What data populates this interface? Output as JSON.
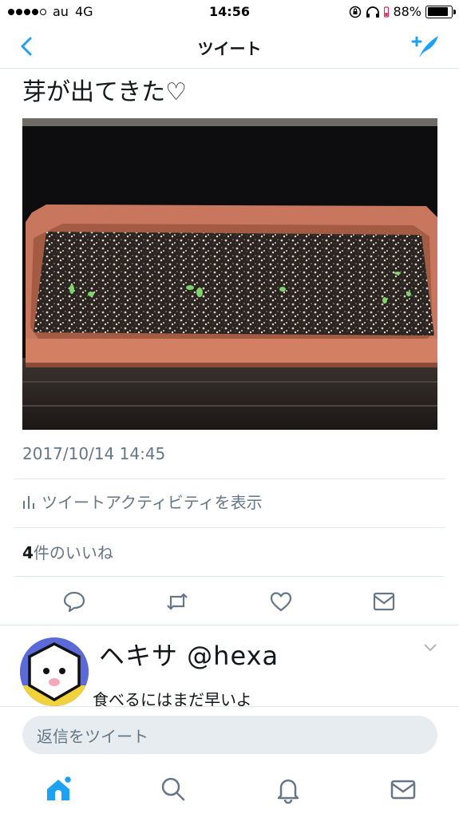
{
  "status_bar": {
    "carrier": "au",
    "network": "4G",
    "time": "14:56",
    "battery": "88%",
    "battery_level": 0.88
  },
  "nav": {
    "title": "ツイート",
    "back_icon": "chevron-left-icon",
    "compose_icon": "compose-tweet-icon"
  },
  "tweet": {
    "text": "芽が出てきた♡",
    "timestamp": "2017/10/14 14:45",
    "activity_label": "ツイートアクティビティを表示",
    "likes_count": "4",
    "likes_label": "件のいいね"
  },
  "actions": [
    "reply-icon",
    "retweet-icon",
    "like-icon",
    "dm-icon"
  ],
  "reply": {
    "name": "ヘキサ @hexa",
    "text": "食べるにはまだ早いよ"
  },
  "composer": {
    "placeholder": "返信をツイート"
  },
  "tabbar": [
    "home-icon",
    "search-icon",
    "notifications-icon",
    "messages-icon"
  ],
  "colors": {
    "accent": "#1da1f2",
    "secondary_text": "#657786",
    "divider": "#e1e8ed"
  }
}
